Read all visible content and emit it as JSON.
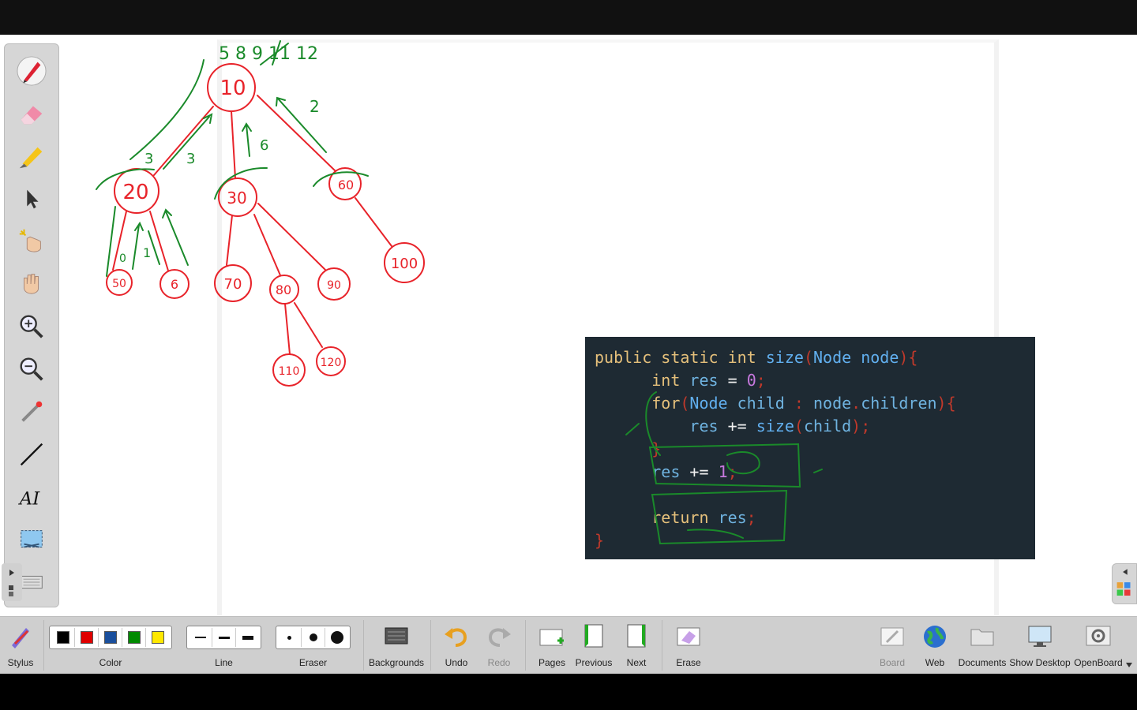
{
  "toolbar_left": {
    "tools": [
      {
        "name": "pen-icon"
      },
      {
        "name": "eraser-icon"
      },
      {
        "name": "highlighter-icon"
      },
      {
        "name": "selector-icon"
      },
      {
        "name": "interact-icon"
      },
      {
        "name": "hand-icon"
      },
      {
        "name": "zoom-in-icon"
      },
      {
        "name": "zoom-out-icon"
      },
      {
        "name": "laser-pointer-icon"
      },
      {
        "name": "line-icon"
      },
      {
        "name": "text-icon"
      },
      {
        "name": "capture-icon"
      },
      {
        "name": "keyboard-icon"
      }
    ],
    "text_tool_label": "AI"
  },
  "code": {
    "lines": [
      [
        "public static int size(Node node){"
      ],
      [
        "int res = 0;"
      ],
      [
        "for(Node child : node.children){"
      ],
      [
        "res += size(child);"
      ],
      [
        "}"
      ],
      [
        "res += 1;"
      ],
      [
        ""
      ],
      [
        "return res;"
      ],
      [
        "}"
      ]
    ],
    "tokens": {
      "l1_public": "public",
      "l1_static": "static",
      "l1_int": "int",
      "l1_size": "size",
      "l1_p1": "(",
      "l1_Node": "Node",
      "l1_node": "node",
      "l1_p2": "){",
      "l2_int": "int",
      "l2_res": "res",
      "l2_eq": "=",
      "l2_zero": "0",
      "l2_semi": ";",
      "l3_for": "for",
      "l3_p1": "(",
      "l3_Node": "Node",
      "l3_child": "child",
      "l3_colon": ":",
      "l3_node": "node",
      "l3_dot": ".",
      "l3_children": "children",
      "l3_p2": "){",
      "l4_res": "res",
      "l4_op": "+=",
      "l4_size": "size",
      "l4_p1": "(",
      "l4_child": "child",
      "l4_p2": ");",
      "l5_brace": "}",
      "l6_res": "res",
      "l6_op": "+=",
      "l6_one": "1",
      "l6_semi": ";",
      "l8_return": "return",
      "l8_res": "res",
      "l8_semi": ";",
      "l9_brace": "}"
    }
  },
  "tree_labels": {
    "root": "10",
    "n20": "20",
    "n30": "30",
    "n60": "60",
    "n50": "50",
    "n6": "6",
    "n70": "70",
    "n80": "80",
    "n90": "90",
    "n100": "100",
    "n110": "110",
    "n120": "120"
  },
  "annotations": {
    "order_text": "5 8 9 11 12",
    "a3_left": "3",
    "a3_right": "3",
    "a6": "6",
    "a2": "2",
    "a1": "1",
    "a0": "0"
  },
  "bottom_bar": {
    "stylus": "Stylus",
    "color": "Color",
    "line": "Line",
    "eraser": "Eraser",
    "backgrounds": "Backgrounds",
    "undo": "Undo",
    "redo": "Redo",
    "pages": "Pages",
    "previous": "Previous",
    "next": "Next",
    "erase": "Erase",
    "board": "Board",
    "web": "Web",
    "documents": "Documents",
    "show_desktop": "Show Desktop",
    "openboard": "OpenBoard"
  },
  "colors": {
    "black": "#000000",
    "red": "#e00000",
    "blue": "#1a4f9c",
    "green": "#008a00",
    "yellow": "#ffe800",
    "ink_red": "#e8232a",
    "ink_green": "#1a8a2a"
  }
}
